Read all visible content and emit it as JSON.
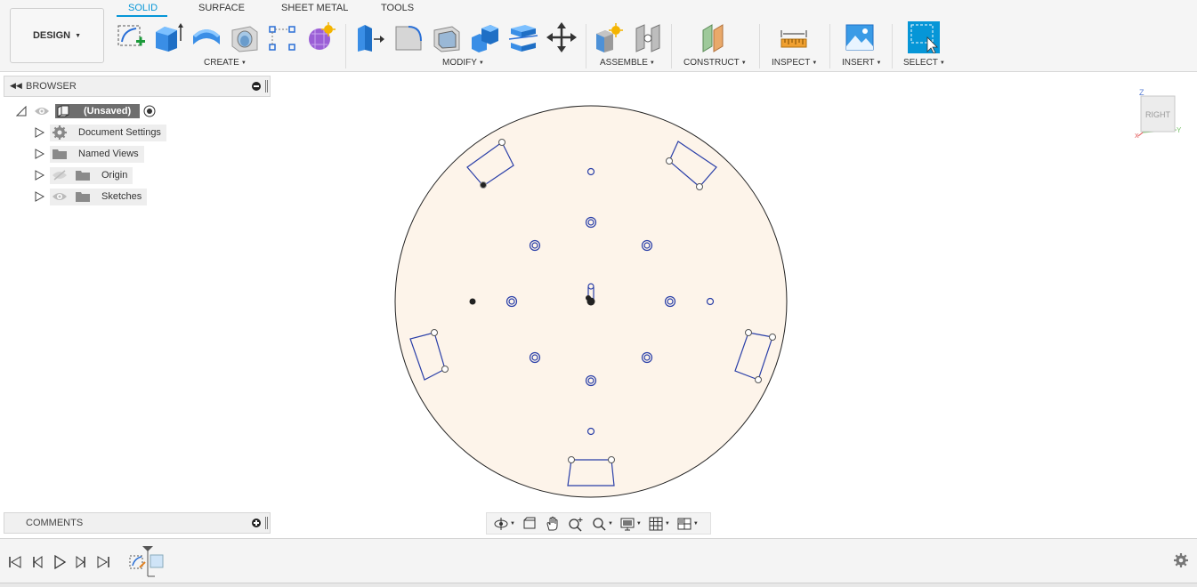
{
  "toolbar": {
    "design_label": "DESIGN",
    "tabs": [
      {
        "label": "SOLID",
        "active": true
      },
      {
        "label": "SURFACE",
        "active": false
      },
      {
        "label": "SHEET METAL",
        "active": false
      },
      {
        "label": "TOOLS",
        "active": false
      }
    ],
    "groups": {
      "create": "CREATE",
      "modify": "MODIFY",
      "assemble": "ASSEMBLE",
      "construct": "CONSTRUCT",
      "inspect": "INSPECT",
      "insert": "INSERT",
      "select": "SELECT"
    },
    "accent_color": "#0696d7"
  },
  "browser": {
    "title": "BROWSER",
    "root_label": "(Unsaved)",
    "items": [
      {
        "label": "Document Settings",
        "icon": "gear-icon"
      },
      {
        "label": "Named Views",
        "icon": "folder-icon"
      },
      {
        "label": "Origin",
        "icon": "folder-icon"
      },
      {
        "label": "Sketches",
        "icon": "folder-icon"
      }
    ]
  },
  "viewcube": {
    "face_label": "RIGHT",
    "axis_z": "Z",
    "axis_y": "Y",
    "axis_x": "X"
  },
  "comments": {
    "title": "COMMENTS"
  },
  "canvas": {
    "disc_fill": "#fdf4ea",
    "sketch_color": "#2a3fa8"
  }
}
